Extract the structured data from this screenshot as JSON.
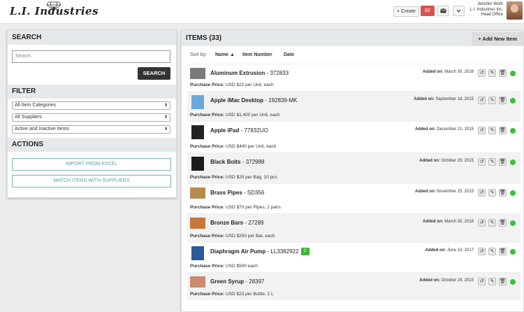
{
  "header": {
    "logo": "L.I. Industries",
    "create_label": "+ Create",
    "notifications": "82",
    "user_name": "Jennifer Work",
    "user_company": "L.I. Industries Inc.",
    "user_office": "Head Office"
  },
  "search": {
    "title": "SEARCH",
    "placeholder": "Search",
    "button": "SEARCH"
  },
  "filter": {
    "title": "FILTER",
    "category": "All Item Categories",
    "supplier": "All Suppliers",
    "status": "Active and Inactive Items"
  },
  "actions": {
    "title": "ACTIONS",
    "import": "IMPORT FROM EXCEL",
    "match": "MATCH ITEMS WITH SUPPLIERS"
  },
  "items_panel": {
    "title": "ITEMS (33)",
    "add_button": "+ Add New Item",
    "sort_by": "Sort by:",
    "sort_name": "Name ▲",
    "sort_number": "Item Number",
    "sort_date": "Date"
  },
  "items": [
    {
      "name": "Aluminum Extrusion",
      "number": " - 372833",
      "price_label": "Purchase Price:",
      "price": " USD $22 per Unit, each",
      "added_label": "Added on:",
      "added": " March 30, 2016",
      "thumb": "#7a7a7a"
    },
    {
      "name": "Apple iMac Desktop",
      "number": " - 192839-MK",
      "price_label": "Purchase Price:",
      "price": " USD $1,400 per Unit, each",
      "added_label": "Added on:",
      "added": " September 18, 2015",
      "thumb": "#6aa8d8"
    },
    {
      "name": "Apple iPad",
      "number": " - 77832UO",
      "price_label": "Purchase Price:",
      "price": " USD $440 per Unit, each",
      "added_label": "Added on:",
      "added": " December 21, 2015",
      "thumb": "#222222"
    },
    {
      "name": "Black Bolts",
      "number": " - 372988",
      "price_label": "Purchase Price:",
      "price": " USD $20 per Bag, 10 pcs",
      "added_label": "Added on:",
      "added": " October 29, 2015",
      "thumb": "#1a1a1a"
    },
    {
      "name": "Brass Pipes",
      "number": " - SD356",
      "price_label": "Purchase Price:",
      "price": " USD $70 per Pipes, 2 pairs",
      "added_label": "Added on:",
      "added": " November 25, 2015",
      "thumb": "#b88a4a"
    },
    {
      "name": "Bronze Bars",
      "number": " - 27289",
      "price_label": "Purchase Price:",
      "price": " USD $250 per Bar, each",
      "added_label": "Added on:",
      "added": " March 30, 2016",
      "thumb": "#c7773a"
    },
    {
      "name": "Diaphragm Air Pump",
      "number": " - LL3382922",
      "badge": "C",
      "price_label": "Purchase Price:",
      "price": " USD $500 each",
      "added_label": "Added on:",
      "added": " June 13, 2017",
      "thumb": "#2c5b9a"
    },
    {
      "name": "Green Syrup",
      "number": " - 28397",
      "price_label": "Purchase Price:",
      "price": " USD $23 per Bottle, 2 L",
      "added_label": "Added on:",
      "added": " October 29, 2015",
      "thumb": "#c98a70"
    }
  ]
}
